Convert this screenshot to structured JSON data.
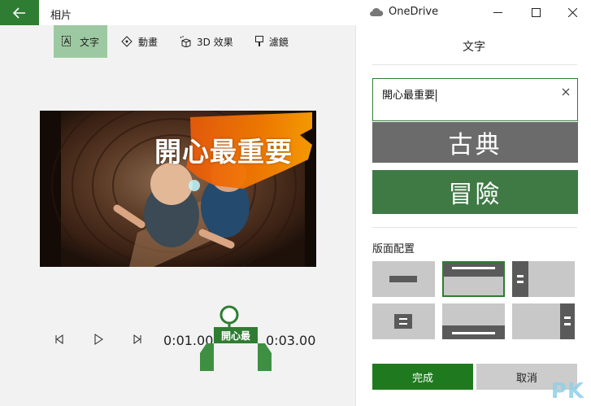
{
  "window": {
    "title": "相片",
    "onedrive_label": "OneDrive"
  },
  "toolbar": {
    "items": [
      {
        "label": "文字",
        "icon": "text-icon",
        "active": true
      },
      {
        "label": "動畫",
        "icon": "motion-icon",
        "active": false
      },
      {
        "label": "3D 效果",
        "icon": "3d-effects-icon",
        "active": false
      },
      {
        "label": "濾鏡",
        "icon": "filter-icon",
        "active": false
      }
    ]
  },
  "preview": {
    "overlay_text": "開心最重要"
  },
  "timeline": {
    "start_time": "0:01.00",
    "end_time": "0:03.00",
    "marker_label": "開心最"
  },
  "panel": {
    "title": "文字",
    "text_input_value": "開心最重要",
    "styles": [
      {
        "label": "古典",
        "color": "#6b6b6b"
      },
      {
        "label": "冒險",
        "color": "#3f7a45"
      }
    ],
    "layout_label": "版面配置",
    "done_label": "完成",
    "cancel_label": "取消"
  },
  "colors": {
    "accent": "#2e7d32",
    "toolbar_active": "#9dc9a2"
  },
  "watermark": "PK"
}
